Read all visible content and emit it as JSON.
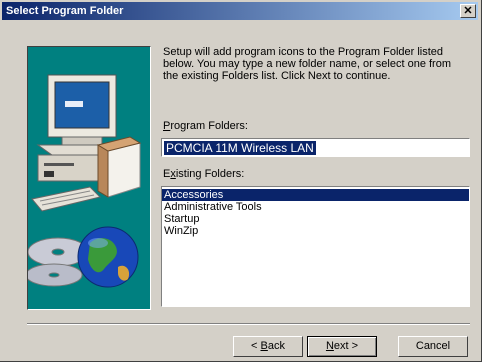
{
  "window": {
    "title": "Select Program Folder",
    "close_glyph": "✕"
  },
  "instructions": "Setup will add program icons to the Program Folder listed below. You may type a new folder name, or select one from the existing Folders list.  Click Next to continue.",
  "program_folders": {
    "label_accel": "P",
    "label_rest": "rogram Folders:",
    "value": "PCMCIA 11M Wireless LAN"
  },
  "existing_folders": {
    "label_first": "E",
    "label_accel": "x",
    "label_rest": "isting Folders:",
    "items": [
      "Accessories",
      "Administrative Tools",
      "Startup",
      "WinZip"
    ],
    "selected": "Accessories"
  },
  "buttons": {
    "back_prefix": "< ",
    "back_accel": "B",
    "back_rest": "ack",
    "next_accel": "N",
    "next_rest": "ext >",
    "cancel": "Cancel"
  },
  "colors": {
    "accent": "#0a246a",
    "art_bg": "#008080",
    "face": "#d4d0c8"
  },
  "icons": [
    "computer-icon",
    "cd-disc-icon",
    "globe-icon",
    "close-icon"
  ]
}
